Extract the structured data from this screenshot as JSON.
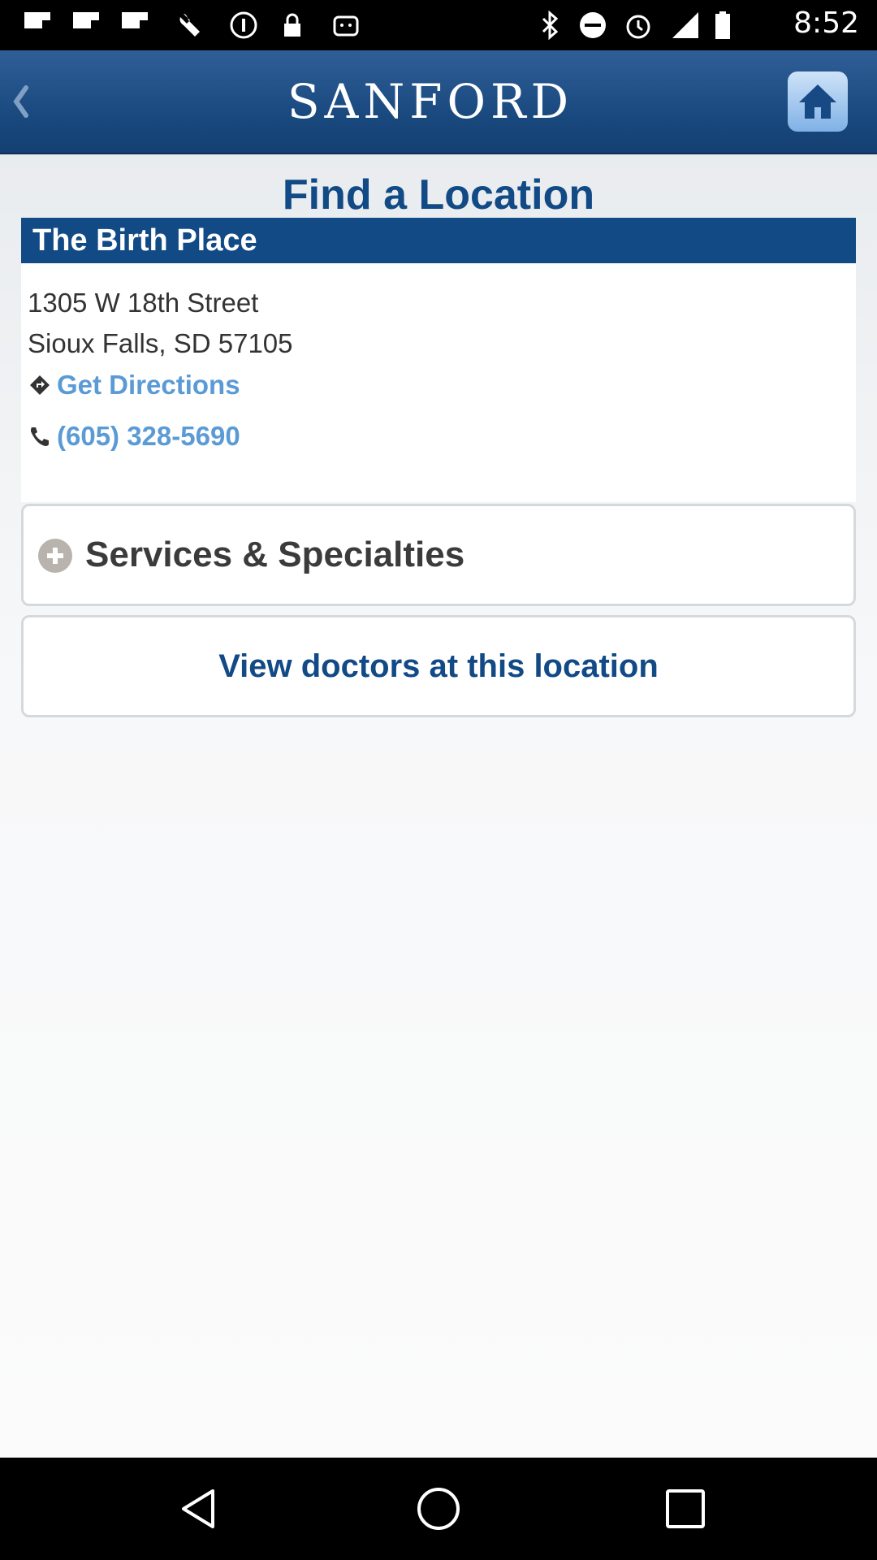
{
  "status_bar": {
    "time": "8:52",
    "icons": [
      "flipboard-icon",
      "flipboard-icon",
      "flipboard-icon",
      "wrench-icon",
      "info-icon",
      "lock-icon",
      "android-icon",
      "bluetooth-icon",
      "do-not-disturb-icon",
      "alarm-icon",
      "signal-icon",
      "battery-icon"
    ]
  },
  "header": {
    "logo_text": "SANFORD",
    "back_icon": "chevron-left-icon",
    "home_icon": "home-icon"
  },
  "page": {
    "title": "Find a Location"
  },
  "location": {
    "name": "The Birth Place",
    "address_line1": "1305 W 18th Street",
    "address_line2": "Sioux Falls, SD 57105",
    "directions_label": "Get Directions",
    "directions_icon": "directions-icon",
    "phone": "(605) 328-5690",
    "phone_icon": "phone-icon"
  },
  "services": {
    "label": "Services & Specialties",
    "icon": "plus-circle-icon"
  },
  "doctors": {
    "label": "View doctors at this location"
  },
  "nav_bar": {
    "back_icon": "back-triangle-icon",
    "home_icon": "home-circle-icon",
    "recents_icon": "recents-square-icon"
  },
  "colors": {
    "header_blue": "#1a4a80",
    "title_blue": "#124a86",
    "link_blue": "#5b9bd5"
  }
}
